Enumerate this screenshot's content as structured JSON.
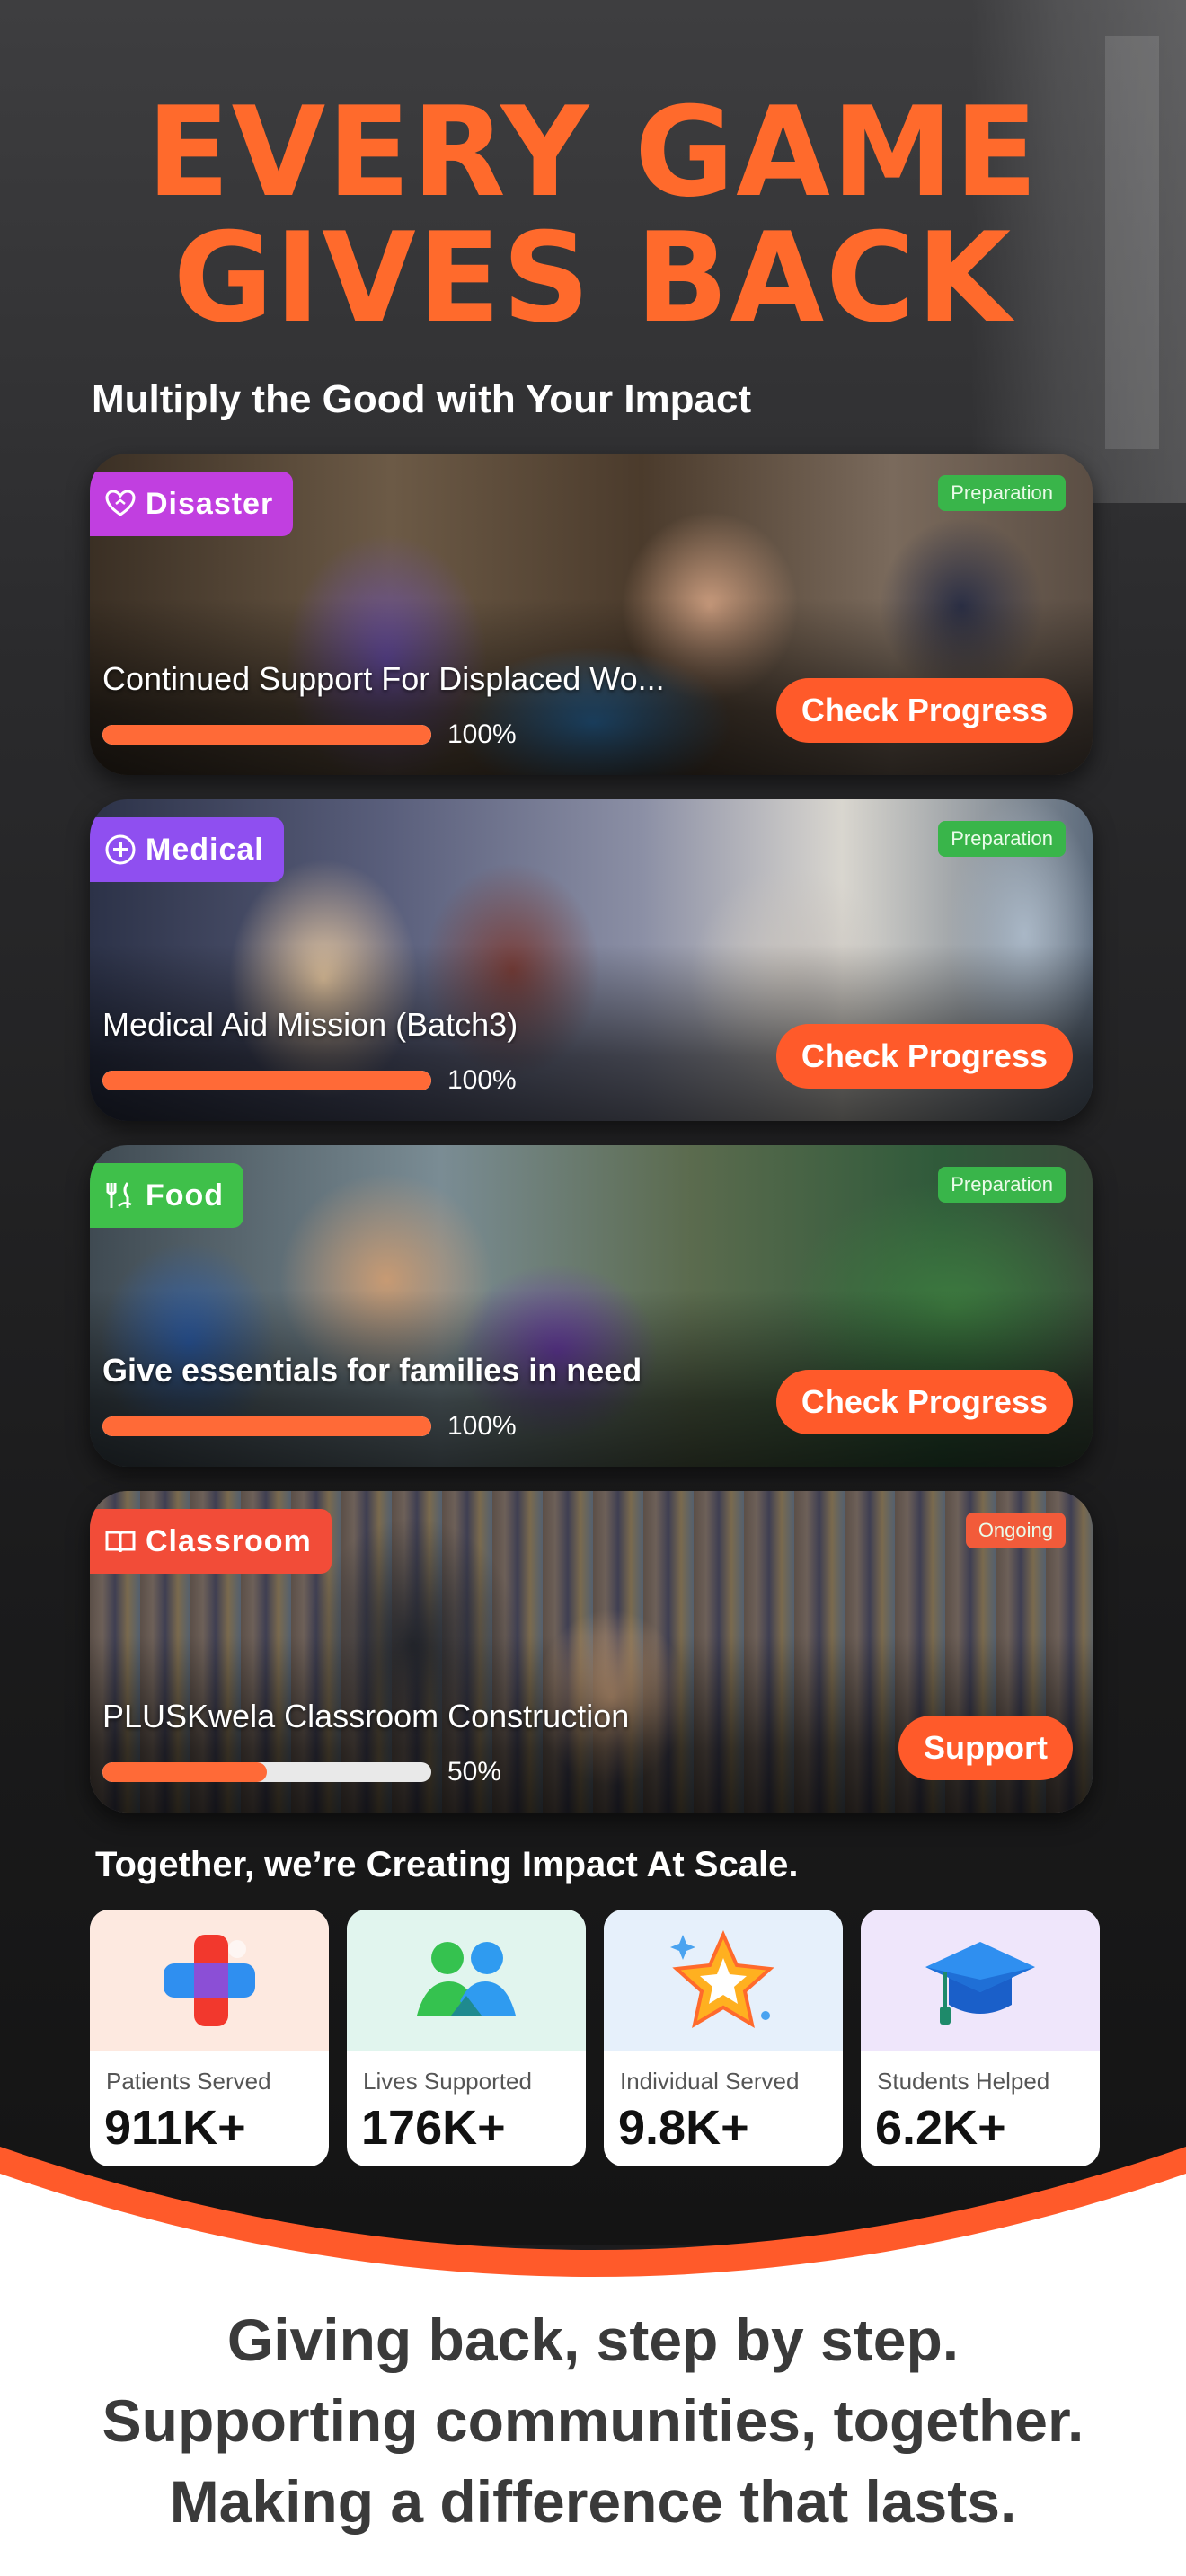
{
  "hero": {
    "title_line1": "EVERY GAME",
    "title_line2": "GIVES BACK",
    "subtitle": "Multiply the Good with Your Impact"
  },
  "campaigns": [
    {
      "category": "Disaster",
      "category_icon": "heart-hand-icon",
      "status": "Preparation",
      "title": "Continued Support For Displaced Wo...",
      "progress": 1.0,
      "progress_label": "100%",
      "button_label": "Check Progress"
    },
    {
      "category": "Medical",
      "category_icon": "medical-cross-icon",
      "status": "Preparation",
      "title": "Medical Aid Mission (Batch3)",
      "progress": 1.0,
      "progress_label": "100%",
      "button_label": "Check Progress"
    },
    {
      "category": "Food",
      "category_icon": "utensils-icon",
      "status": "Preparation",
      "title": "Give essentials for families in need",
      "progress": 1.0,
      "progress_label": "100%",
      "button_label": "Check Progress"
    },
    {
      "category": "Classroom",
      "category_icon": "book-icon",
      "status": "Ongoing",
      "title": "PLUSKwela Classroom Construction",
      "progress": 0.5,
      "progress_label": "50%",
      "button_label": "Support"
    }
  ],
  "impact": {
    "heading": "Together, we’re Creating Impact At Scale.",
    "stats": [
      {
        "label": "Patients Served",
        "value": "911K+",
        "icon": "medical-cross-icon"
      },
      {
        "label": "Lives Supported",
        "value": "176K+",
        "icon": "people-icon"
      },
      {
        "label": "Individual Served",
        "value": "9.8K+",
        "icon": "star-icon"
      },
      {
        "label": "Students Helped",
        "value": "6.2K+",
        "icon": "graduation-cap-icon"
      }
    ]
  },
  "tagline": {
    "line1": "Giving back, step by step.",
    "line2": "Supporting communities, together.",
    "line3": "Making a difference that lasts."
  },
  "colors": {
    "accent": "#ff6a2c",
    "button": "#ff5a2a",
    "disaster": "#c13fe0",
    "medical": "#8f4ff0",
    "food": "#3fc04a",
    "classroom": "#f24c38"
  }
}
